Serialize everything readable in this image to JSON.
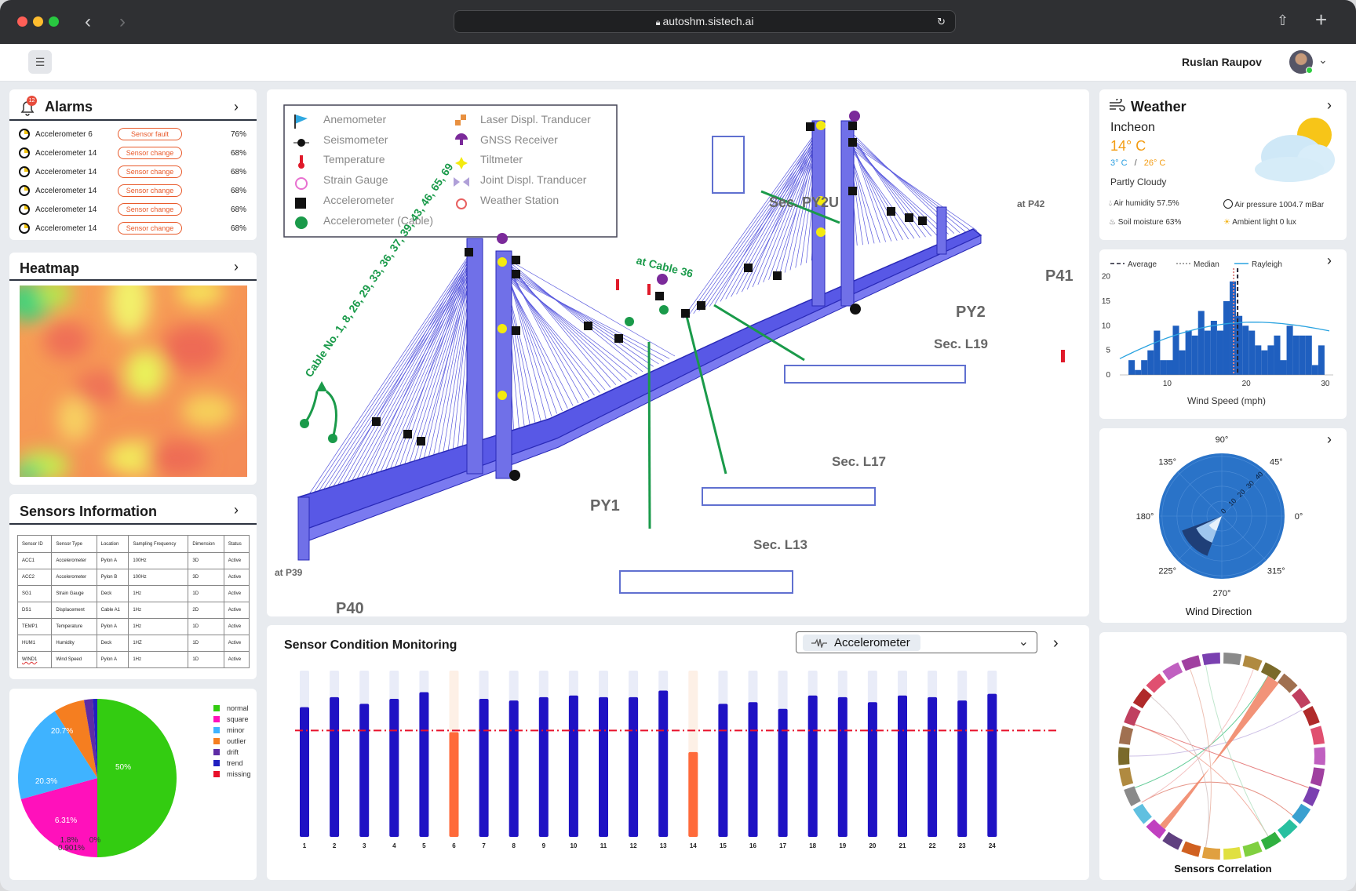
{
  "browser": {
    "url": "autoshm.sistech.ai"
  },
  "header": {
    "user_name": "Ruslan Raupov"
  },
  "alarms": {
    "title": "Alarms",
    "badge_count": "12",
    "rows": [
      {
        "sensor": "Accelerometer 6",
        "status": "Sensor fault",
        "value": "76%"
      },
      {
        "sensor": "Accelerometer 14",
        "status": "Sensor change",
        "value": "68%"
      },
      {
        "sensor": "Accelerometer 14",
        "status": "Sensor change",
        "value": "68%"
      },
      {
        "sensor": "Accelerometer 14",
        "status": "Sensor change",
        "value": "68%"
      },
      {
        "sensor": "Accelerometer 14",
        "status": "Sensor change",
        "value": "68%"
      },
      {
        "sensor": "Accelerometer 14",
        "status": "Sensor change",
        "value": "68%"
      }
    ]
  },
  "heatmap": {
    "title": "Heatmap"
  },
  "sensors_info": {
    "title": "Sensors Information",
    "columns": [
      "Sensor ID",
      "Sensor Type",
      "Location",
      "Sampling Frequency",
      "Dimension",
      "Status"
    ],
    "rows": [
      [
        "ACC1",
        "Accelerometer",
        "Pylon A",
        "100Hz",
        "3D",
        "Active"
      ],
      [
        "ACC2",
        "Accelerometer",
        "Pylon B",
        "100Hz",
        "3D",
        "Active"
      ],
      [
        "SG1",
        "Strain Gauge",
        "Deck",
        "1Hz",
        "1D",
        "Active"
      ],
      [
        "DS1",
        "Displacement",
        "Cable A1",
        "1Hz",
        "2D",
        "Active"
      ],
      [
        "TEMP1",
        "Temperature",
        "Pylon A",
        "1Hz",
        "1D",
        "Active"
      ],
      [
        "HUM1",
        "Humidity",
        "Deck",
        "1HZ",
        "1D",
        "Active"
      ],
      [
        "WIND1",
        "Wind Speed",
        "Pylon A",
        "1Hz",
        "1D",
        "Active"
      ]
    ]
  },
  "distribution_pie": {
    "chart_data": {
      "type": "pie",
      "categories": [
        "normal",
        "square",
        "minor",
        "outlier",
        "drift",
        "trend",
        "missing"
      ],
      "values": [
        50,
        20.7,
        20.3,
        6.31,
        1.8,
        0.901,
        0
      ],
      "labels": [
        "50%",
        "20.7%",
        "20.3%",
        "6.31%",
        "1.8%",
        "0.901%",
        "0%"
      ],
      "colors": [
        "#33cc11",
        "#ff11bb",
        "#3fb3ff",
        "#f57e20",
        "#5e2ca5",
        "#2020c0",
        "#e8102a"
      ]
    }
  },
  "bridge": {
    "legend": [
      "Anemometer",
      "Seismometer",
      "Temperature",
      "Strain Gauge",
      "Accelerometer",
      "Accelerometer (Cable)",
      "Laser Displ. Tranducer",
      "GNSS Receiver",
      "Tiltmeter",
      "Joint Displ. Tranducer",
      "Weather Station"
    ],
    "labels": {
      "sec_py2u": "Sec. PY2U",
      "sec_l19": "Sec. L19",
      "sec_l17": "Sec. L17",
      "sec_l13": "Sec. L13",
      "py1": "PY1",
      "py2": "PY2",
      "p40": "P40",
      "p41": "P41",
      "at_p42": "at P42",
      "at_p39": "at P39",
      "at_cable36": "at Cable 36",
      "cable_nos": "Cable No. 1, 8, 26, 29, 33, 36, 37, 39, 43, 46, 65, 69"
    }
  },
  "weather": {
    "title": "Weather",
    "city": "Incheon",
    "temperature": "14° C",
    "temp_min": "3° C",
    "temp_sep": "/",
    "temp_max": "26° C",
    "condition": "Partly Cloudy",
    "air_humidity": "Air humidity 57.5%",
    "air_pressure": "Air pressure 1004.7 mBar",
    "soil_moisture": "Soil moisture 63%",
    "ambient_light": "Ambient light 0 lux"
  },
  "wind_speed": {
    "chart_data": {
      "type": "bar",
      "xlabel": "Wind Speed (mph)",
      "legend": [
        "Average",
        "Median",
        "Rayleigh"
      ],
      "x": [
        5.5,
        6.3,
        7.1,
        7.9,
        8.7,
        9.5,
        10.3,
        11.1,
        11.9,
        12.7,
        13.5,
        14.3,
        15.1,
        15.9,
        16.7,
        17.5,
        18.3,
        19.1,
        19.9,
        20.7,
        21.5,
        22.3,
        23.1,
        23.9,
        24.7,
        25.5,
        26.3,
        27.1,
        27.9,
        28.7,
        29.5
      ],
      "values": [
        3,
        1,
        3,
        5,
        9,
        3,
        3,
        10,
        5,
        9,
        8,
        13,
        9,
        11,
        9,
        15,
        19,
        12,
        10,
        9,
        6,
        5,
        6,
        8,
        3,
        10,
        8,
        8,
        8,
        2,
        6
      ],
      "average": 18.9,
      "median": 18.4,
      "xlim": [
        4,
        31
      ],
      "ylim": [
        0,
        22
      ],
      "xticks": [
        10,
        20,
        30
      ],
      "yticks": [
        0,
        5,
        10,
        15,
        20
      ]
    }
  },
  "wind_direction": {
    "title": "Wind Direction",
    "angle_labels": [
      "0°",
      "45°",
      "90°",
      "135°",
      "180°",
      "225°",
      "270°",
      "315°"
    ],
    "radial_ticks": [
      "0",
      "10",
      "20",
      "30",
      "40"
    ]
  },
  "correlation": {
    "title": "Sensors Correlation"
  },
  "condition_monitoring": {
    "title": "Sensor Condition Monitoring",
    "selected": "Accelerometer",
    "chart_data": {
      "type": "bar",
      "categories": [
        "1",
        "2",
        "3",
        "4",
        "5",
        "6",
        "7",
        "8",
        "9",
        "10",
        "11",
        "12",
        "13",
        "14",
        "15",
        "16",
        "17",
        "18",
        "19",
        "20",
        "21",
        "22",
        "23",
        "24"
      ],
      "values": [
        78,
        84,
        80,
        83,
        87,
        63,
        83,
        82,
        84,
        85,
        84,
        84,
        88,
        51,
        80,
        81,
        77,
        85,
        84,
        81,
        85,
        84,
        82,
        86
      ],
      "threshold": 64,
      "ylim": [
        0,
        100
      ],
      "colors": {
        "normal": "#1f12c4",
        "warning": "#ff6a3a",
        "track": "#e9ecf8",
        "track_warning": "#fdf0e6",
        "threshold": "#e8102a"
      }
    }
  }
}
